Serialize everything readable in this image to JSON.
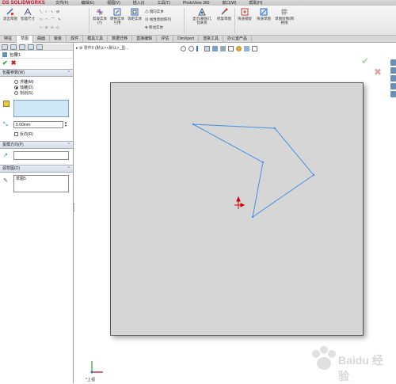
{
  "app": {
    "logo": "DS SOLIDWORKS",
    "photoview": "PhotoView 360"
  },
  "menu": [
    "文件(F)",
    "编辑(E)",
    "视图(V)",
    "插入(I)",
    "工具(T)",
    "PhotoView 360",
    "窗口(W)",
    "帮助(H)"
  ],
  "ribbon": {
    "buttons": [
      {
        "label": "退出草图",
        "icon": "exit-sketch-icon"
      },
      {
        "label": "智能尺寸",
        "icon": "smart-dimension-icon"
      },
      {
        "label": "剪裁实体(T)",
        "icon": "trim-icon"
      },
      {
        "label": "转换实体引用",
        "icon": "convert-entities-icon"
      },
      {
        "label": "等距实体",
        "icon": "offset-entities-icon"
      },
      {
        "label": "显示/删除几何关系",
        "icon": "relations-icon"
      },
      {
        "label": "修复草图",
        "icon": "repair-sketch-icon"
      },
      {
        "label": "快速捕捉",
        "icon": "quick-snap-icon"
      },
      {
        "label": "快速草图",
        "icon": "rapid-sketch-icon"
      },
      {
        "label": "草图绘制/网格线",
        "icon": "grid-icon"
      }
    ],
    "small": [
      "镜向实体",
      "线性草图阵列",
      "移动实体"
    ]
  },
  "tabs": [
    "特征",
    "草图",
    "曲面",
    "钣金",
    "焊件",
    "模具工具",
    "数据迁移",
    "直接编辑",
    "评估",
    "DimXpert",
    "渲染工具",
    "办公室产品"
  ],
  "active_tab": 1,
  "panel": {
    "feature_name": "包覆1",
    "wrap_params_header": "包覆参数(W)",
    "wrap_types": [
      "浮雕(M)",
      "蚀雕(D)",
      "刻划(S)"
    ],
    "selected_wrap_type": 1,
    "thickness": "5.00mm",
    "reverse_label": "反向(R)",
    "pull_dir_header": "拔模方向(P)",
    "source_sketch_header": "源草图(O)",
    "source_sketch_value": "草图5"
  },
  "viewport": {
    "breadcrumb": "零件6 (默认<<默认>_显...",
    "view_label": "*上视"
  },
  "watermark": "Baidu 经验",
  "colors": {
    "sketch": "#4a90e2",
    "sheet": "#d6d6d6",
    "origin_red": "#cc0000"
  }
}
